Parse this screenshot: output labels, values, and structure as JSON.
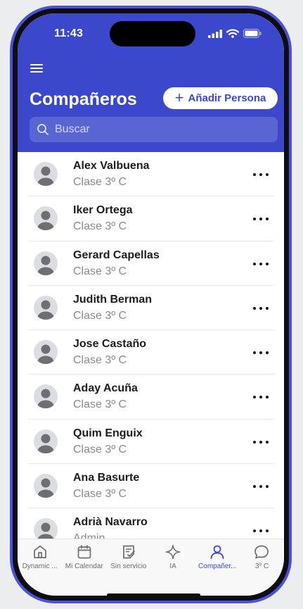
{
  "status_bar": {
    "time": "11:43"
  },
  "header": {
    "title": "Compañeros",
    "add_button_label": "Añadir Persona",
    "search_placeholder": "Buscar"
  },
  "contacts": [
    {
      "name": "Alex Valbuena",
      "role": "Clase 3º C"
    },
    {
      "name": "Iker Ortega",
      "role": "Clase 3º C"
    },
    {
      "name": "Gerard Capellas",
      "role": "Clase 3º C"
    },
    {
      "name": "Judith Berman",
      "role": "Clase 3º C"
    },
    {
      "name": "Jose Castaño",
      "role": "Clase 3º C"
    },
    {
      "name": "Aday Acuña",
      "role": "Clase 3º C"
    },
    {
      "name": "Quim Enguix",
      "role": "Clase 3º C"
    },
    {
      "name": "Ana Basurte",
      "role": "Clase 3º C"
    },
    {
      "name": "Adrià Navarro",
      "role": "Admin"
    }
  ],
  "tabs": [
    {
      "label": "Dynamic ...",
      "icon": "home-icon",
      "active": false
    },
    {
      "label": "Mi Calendar",
      "icon": "calendar-icon",
      "active": false
    },
    {
      "label": "Sin servicio",
      "icon": "checklist-icon",
      "active": false
    },
    {
      "label": "IA",
      "icon": "sparkle-icon",
      "active": false
    },
    {
      "label": "Compañer...",
      "icon": "person-icon",
      "active": true
    },
    {
      "label": "3º C",
      "icon": "chat-bubble-icon",
      "active": false
    }
  ],
  "colors": {
    "brand": "#3b48cc",
    "frame": "#4a52d8",
    "text": "#1c1c1e",
    "muted": "#8a8a8e"
  }
}
